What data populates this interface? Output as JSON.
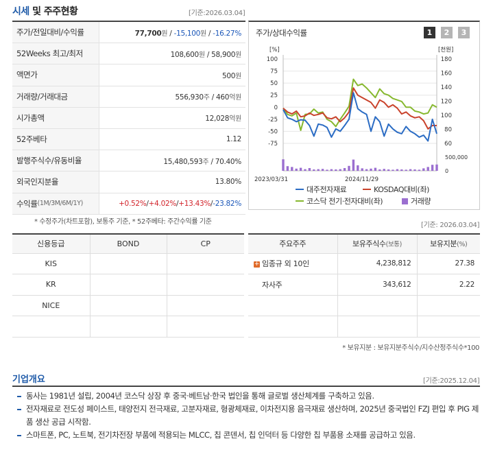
{
  "section_title_a": "시세",
  "section_title_b": "및 주주현황",
  "basis_top": "[기준:2026.03.04]",
  "market": {
    "price_row": {
      "label": "주가/전일대비/수익률",
      "price": "77,700",
      "won": "원",
      "sep1": " / ",
      "change": "-15,100",
      "won2": "원",
      "sep2": " / ",
      "pct": "-16.27%"
    },
    "wk52": {
      "label": "52Weeks 최고/최저",
      "high": "108,600",
      "won": "원",
      "sep": " / ",
      "low": "58,900",
      "won2": "원"
    },
    "par": {
      "label": "액면가",
      "value": "500",
      "won": "원"
    },
    "volume": {
      "label": "거래량/거래대금",
      "value": "556,930",
      "unit1": "주",
      "sep": " / ",
      "value2": "460",
      "unit2": "억원"
    },
    "mcap": {
      "label": "시가총액",
      "value": "12,028",
      "unit": "억원"
    },
    "beta": {
      "label": "52주베타",
      "value": "1.12"
    },
    "shares": {
      "label": "발행주식수/유동비율",
      "value": "15,480,593",
      "unit": "주",
      "sep": " / ",
      "ratio": "70.40%"
    },
    "foreign": {
      "label": "외국인지분율",
      "value": "13.80%"
    },
    "returns": {
      "label": "수익률",
      "sub": " (1M/3M/6M/1Y)",
      "r1": "+0.52%",
      "s1": "/",
      "r2": "+4.02%",
      "s2": "/",
      "r3": "+13.43%",
      "s3": "/",
      "r4": "-23.82%"
    }
  },
  "market_footnote": "* 수정주가(차트포함), 보통주 기준, * 52주베타: 주간수익률 기준",
  "chart": {
    "title": "주가/상대수익률",
    "buttons": [
      "1",
      "2",
      "3"
    ],
    "colors": {
      "stock": "#2b6cc4",
      "kosdaq": "#c9422b",
      "sector": "#86b82e",
      "volume": "#9b6fd0",
      "active_btn": "#333333",
      "btn": "#b5b5b5"
    }
  },
  "chart_data": {
    "type": "line",
    "left_unit": "[%]",
    "right_unit": "[천원]",
    "left_ticks": [
      "100",
      "75",
      "50",
      "25",
      "0",
      "-25",
      "-50",
      "-75"
    ],
    "right_ticks": [
      "180",
      "160",
      "140",
      "120",
      "100",
      "80",
      "60"
    ],
    "volume_tick_labels": [
      "500,000",
      "0"
    ],
    "x_labels": [
      "2023/03/31",
      "2024/11/29"
    ],
    "ylim_left": [
      -75,
      100
    ],
    "ylim_right": [
      60,
      180
    ],
    "volume_max": 500000,
    "series": [
      {
        "name": "대주전자재료",
        "values": [
          -5,
          -22,
          -25,
          -30,
          -26,
          -27,
          -38,
          -60,
          -35,
          -37,
          -42,
          -62,
          -45,
          -50,
          -38,
          -25,
          30,
          -3,
          -10,
          -15,
          -50,
          -20,
          -30,
          -60,
          -35,
          -45,
          -52,
          -55,
          -40,
          -50,
          -55,
          -62,
          -58,
          -70,
          -25,
          -55
        ]
      },
      {
        "name": "KOSDAQ대비(좌)",
        "values": [
          -2,
          -10,
          -14,
          -8,
          -20,
          -18,
          -12,
          -17,
          -15,
          -12,
          -22,
          -24,
          -20,
          -30,
          -22,
          -10,
          40,
          25,
          20,
          15,
          10,
          -2,
          15,
          10,
          0,
          5,
          -2,
          -14,
          -10,
          -18,
          -22,
          -20,
          -28,
          -45,
          -38,
          -38
        ]
      },
      {
        "name": "코스닥 전기·전자대비(좌)",
        "values": [
          -2,
          -15,
          -18,
          -12,
          -48,
          -15,
          -14,
          -4,
          -12,
          -10,
          -25,
          -30,
          -40,
          -25,
          -12,
          2,
          58,
          45,
          48,
          40,
          30,
          20,
          38,
          28,
          25,
          18,
          15,
          12,
          0,
          0,
          -8,
          -10,
          -14,
          -12,
          5,
          0
        ]
      }
    ],
    "volume": [
      420000,
      170000,
      140000,
      80000,
      110000,
      60000,
      100000,
      50000,
      60000,
      70000,
      40000,
      60000,
      50000,
      60000,
      100000,
      180000,
      410000,
      200000,
      90000,
      60000,
      80000,
      110000,
      50000,
      70000,
      50000,
      40000,
      60000,
      50000,
      40000,
      60000,
      50000,
      40000,
      90000,
      140000,
      220000,
      230000
    ],
    "volume_series_name": "거래량"
  },
  "credit": {
    "headers": [
      "신용등급",
      "BOND",
      "CP"
    ],
    "rows": [
      [
        "KIS",
        "",
        ""
      ],
      [
        "KR",
        "",
        ""
      ],
      [
        "NICE",
        "",
        ""
      ],
      [
        "",
        "",
        ""
      ]
    ]
  },
  "basis_holders": "[기준: 2026.03.04]",
  "holders": {
    "headers": [
      "주요주주",
      "보유주식수",
      "(보통)",
      "보유지분",
      "(%)"
    ],
    "rows": [
      {
        "name": "임종규 외 10인",
        "shares": "4,238,812",
        "pct": "27.38",
        "expand": "+"
      },
      {
        "name": "자사주",
        "shares": "343,612",
        "pct": "2.22"
      },
      {
        "name": "",
        "shares": "",
        "pct": ""
      },
      {
        "name": "",
        "shares": "",
        "pct": ""
      }
    ]
  },
  "holders_footnote": "* 보유지분 : 보유지분주식수/지수산정주식수*100",
  "overview": {
    "title": "기업개요",
    "basis": "[기준:2025.12.04]",
    "items": [
      "동사는 1981년 설립, 2004년 코스닥 상장 후 중국·베트남·한국 법인을 통해 글로벌 생산체계를 구축하고 있음.",
      "전자재료로 전도성 페이스트, 태양전지 전극재료, 고분자재료, 형광체재료, 이차전지용 음극재료 생산하며, 2025년 중국법인 FZJ 편입 후 PIG 제품 생산 공급 시작함.",
      "스마트폰, PC, 노트북, 전기차전장 부품에 적용되는 MLCC, 칩 콘덴서, 칩 인덕터 등 다양한 칩 부품용 소재를 공급하고 있음."
    ]
  }
}
